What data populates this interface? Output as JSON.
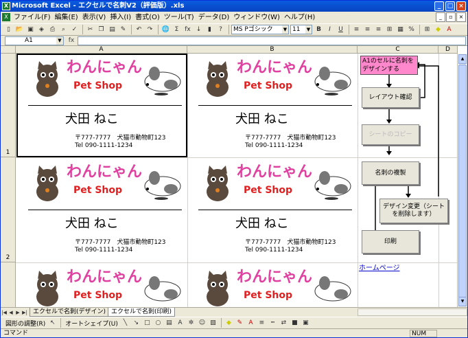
{
  "window": {
    "title": "Microsoft Excel - エクセルで名刺V2（評価版）.xls"
  },
  "menu": [
    "ファイル(F)",
    "編集(E)",
    "表示(V)",
    "挿入(I)",
    "書式(O)",
    "ツール(T)",
    "データ(D)",
    "ウィンドウ(W)",
    "ヘルプ(H)"
  ],
  "toolbar": {
    "font_name": "MS Pゴシック",
    "font_size": "11"
  },
  "formula_bar": {
    "cell_ref": "A1",
    "fx": "fx",
    "value": ""
  },
  "columns": [
    "A",
    "B",
    "C",
    "D"
  ],
  "rows": [
    "1",
    "2"
  ],
  "card": {
    "logo_text": "わんにゃん",
    "shop_text": "Pet Shop",
    "name": "犬田 ねこ",
    "address": "〒777-7777　犬猫市動物町123",
    "tel": "Tel 090-1111-1234"
  },
  "flow": {
    "step1": "A1のセルに名刺をデザインする",
    "step2": "レイアウト確認",
    "step3": "シートのコピー",
    "step4": "名刺の複製",
    "step5": "デザイン変更（シートを削除します）",
    "step6": "印刷"
  },
  "hyperlink": "ホームページ",
  "sheet_tabs": [
    "エクセルで名刺(デザイン)",
    "エクセルで名刺(印刷)"
  ],
  "drawbar": {
    "shapes_label": "図形の調整(R)",
    "autoshape_label": "オートシェイプ(U)"
  },
  "status": {
    "mode": "コマンド",
    "num": "NUM"
  }
}
